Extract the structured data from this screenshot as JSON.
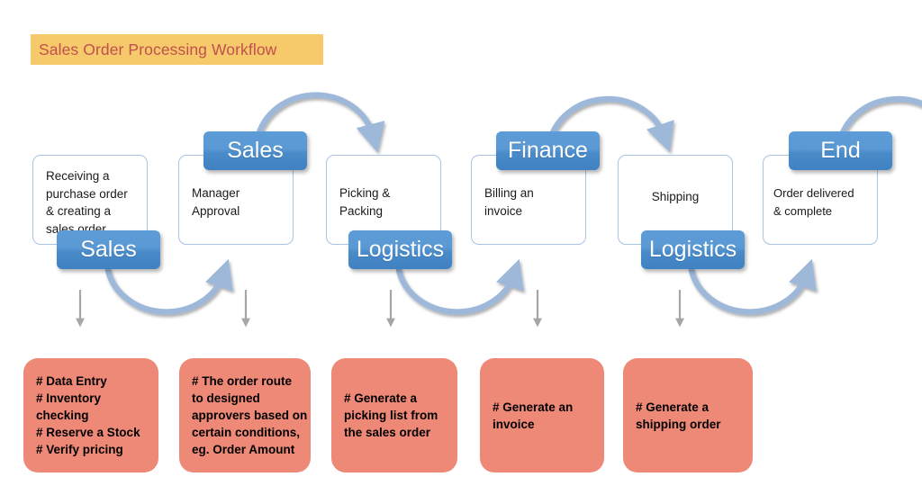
{
  "title": {
    "text": "Sales Order Processing Workflow",
    "banner_color": "#F6C96B",
    "text_color": "#C0504D"
  },
  "theme": {
    "process_border": "#A9C4E4",
    "role_blue": "#5B9BD5",
    "detail_red": "#EE8877",
    "connector_blue": "#9DB8D9",
    "arrow_gray": "#A6A6A6"
  },
  "steps": [
    {
      "id": "step-1",
      "process_text": "Receiving a\npurchase order\n& creating a\nsales order",
      "role_label": "Sales",
      "role_position": "bottom",
      "detail_text": "# Data Entry\n# Inventory checking\n# Reserve a Stock\n# Verify pricing"
    },
    {
      "id": "step-2",
      "process_text": "Manager\nApproval",
      "role_label": "Sales",
      "role_position": "top",
      "detail_text": "# The order route\nto designed\napprovers based on\ncertain conditions,\neg. Order Amount"
    },
    {
      "id": "step-3",
      "process_text": "Picking &\nPacking",
      "role_label": "Logistics",
      "role_position": "bottom",
      "detail_text": "# Generate a\npicking list  from\nthe sales order"
    },
    {
      "id": "step-4",
      "process_text": "Billing an\ninvoice",
      "role_label": "Finance",
      "role_position": "top",
      "detail_text": "# Generate an\ninvoice"
    },
    {
      "id": "step-5",
      "process_text": "Shipping",
      "role_label": "Logistics",
      "role_position": "bottom",
      "detail_text": "# Generate a\nshipping order"
    },
    {
      "id": "step-6",
      "process_text": "Order delivered\n& complete",
      "role_label": "End",
      "role_position": "top",
      "detail_text": ""
    }
  ]
}
